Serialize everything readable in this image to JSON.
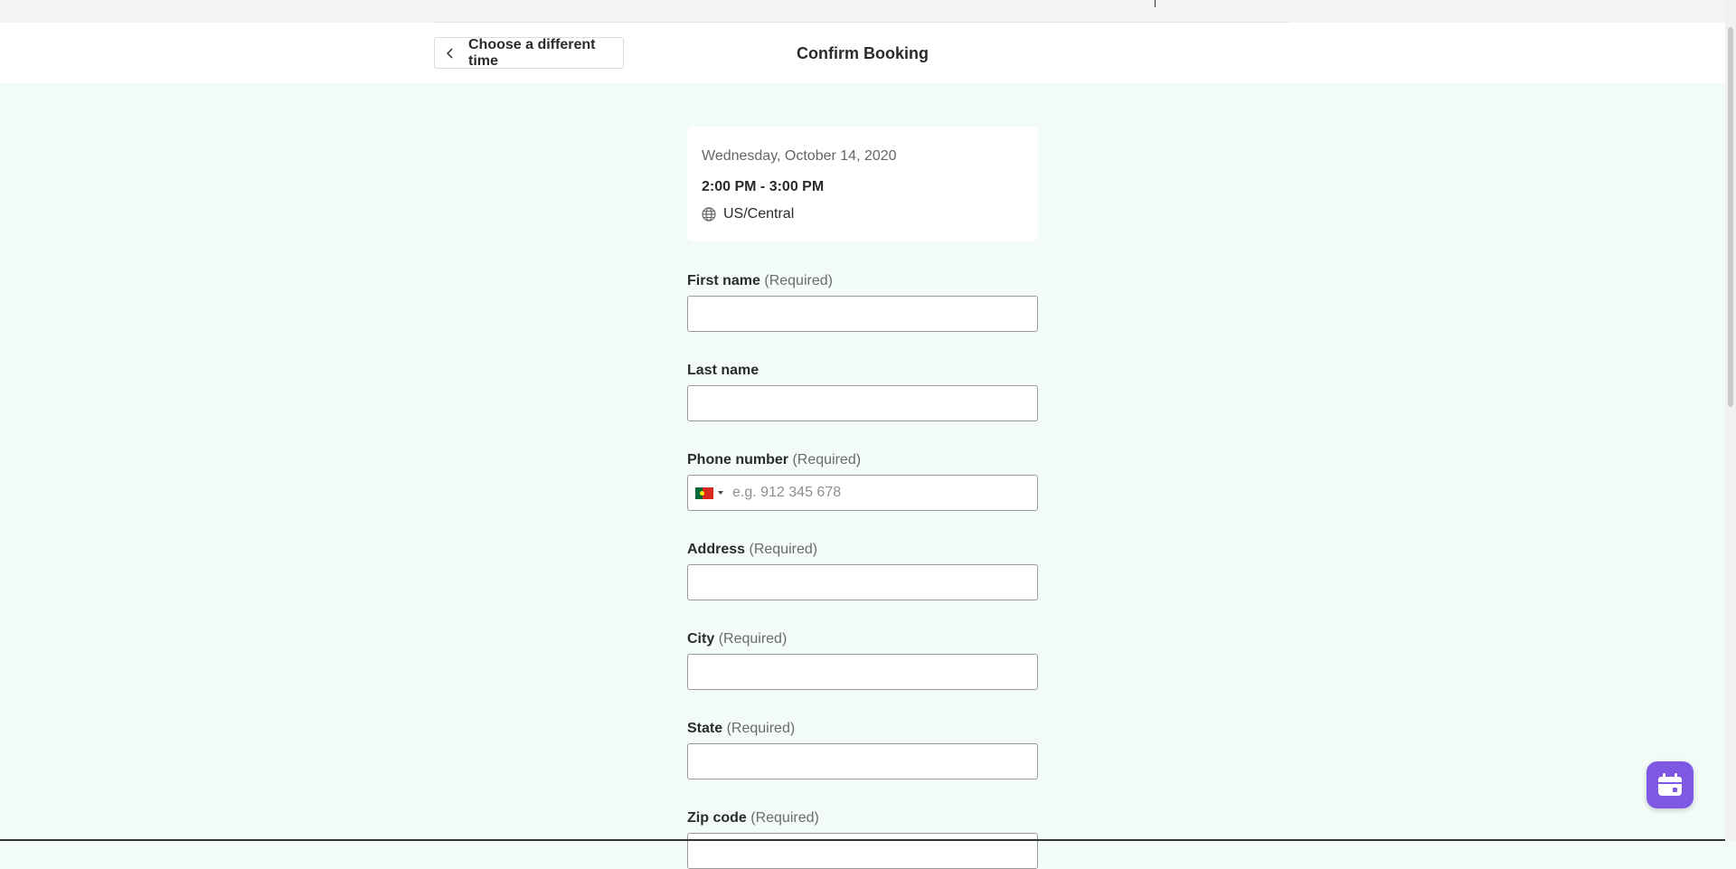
{
  "header": {
    "back_label": "Choose a different time",
    "title": "Confirm Booking"
  },
  "summary": {
    "date": "Wednesday, October 14, 2020",
    "time": "2:00 PM - 3:00 PM",
    "timezone": "US/Central",
    "timezone_icon": "globe-icon"
  },
  "form": {
    "required_text": "(Required)",
    "first_name": {
      "label": "First name",
      "value": ""
    },
    "last_name": {
      "label": "Last name",
      "value": ""
    },
    "phone": {
      "label": "Phone number",
      "placeholder": "e.g. 912 345 678",
      "country_flag": "portugal-flag-icon",
      "value": ""
    },
    "address": {
      "label": "Address",
      "value": ""
    },
    "city": {
      "label": "City",
      "value": ""
    },
    "state": {
      "label": "State",
      "value": ""
    },
    "zip": {
      "label": "Zip code",
      "value": ""
    }
  },
  "fab": {
    "icon": "calendar-icon"
  },
  "colors": {
    "background": "#f2fbf6",
    "accent": "#7e57e2",
    "text": "#2b2b2b"
  }
}
